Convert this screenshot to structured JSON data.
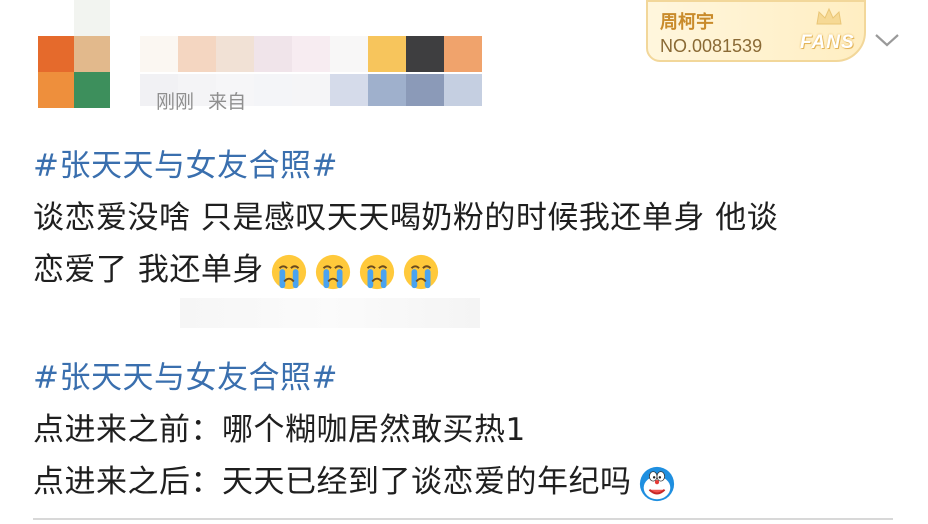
{
  "post": {
    "time_label": "刚刚",
    "source_label": "来自",
    "topic_1": "#张天天与女友合照#",
    "body_1_line_1": "谈恋爱没啥 只是感叹天天喝奶粉的时候我还单身 他谈",
    "body_1_line_2": "恋爱了 我还单身",
    "topic_2": "#张天天与女友合照#",
    "body_2_line_1": "点进来之前：哪个糊咖居然敢买热1",
    "body_2_line_2": "点进来之后：天天已经到了谈恋爱的年纪吗"
  },
  "badge": {
    "name": "周柯宇",
    "number": "NO.0081539",
    "fans_label": "FANS"
  },
  "icons": {
    "emoji_1": "crying-face-icon",
    "emoji_2": "doraemon-face-icon",
    "menu": "chevron-down-icon"
  },
  "colors": {
    "topic_blue": "#3a6fae",
    "badge_gold": "#c98b2b"
  }
}
